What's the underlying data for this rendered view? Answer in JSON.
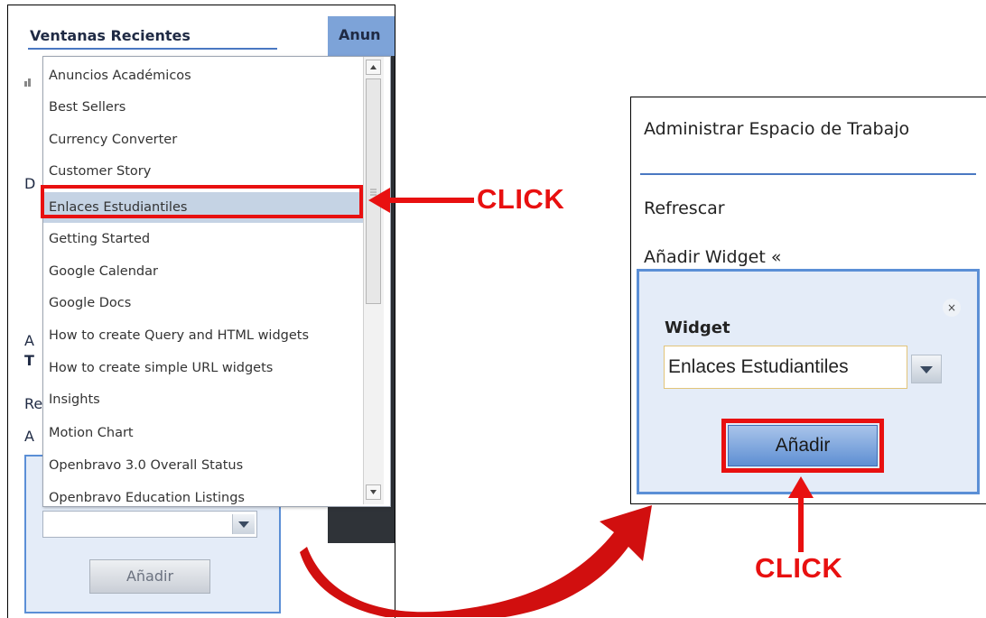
{
  "left": {
    "section_title": "Ventanas Recientes",
    "tab_title": "Anun",
    "peek_d": "D",
    "peek_ad": "A",
    "peek_tr": "T",
    "peek_re": "Re",
    "peek_an": "A",
    "add_button": "Añadir",
    "dropdown": {
      "items": [
        "Anuncios Académicos",
        "Best Sellers",
        "Currency Converter",
        "Customer Story",
        "Enlaces Estudiantiles",
        "Getting Started",
        "Google Calendar",
        "Google Docs",
        "How to create Query and HTML widgets",
        "How to create simple URL widgets",
        "Insights",
        "Motion Chart",
        "Openbravo 3.0 Overall Status",
        "Openbravo Education Listings"
      ],
      "selected_index": 4
    }
  },
  "right": {
    "title": "Administrar Espacio de Trabajo",
    "refresh": "Refrescar",
    "add_widget": "Añadir Widget «",
    "close_icon": "×",
    "widget_label": "Widget",
    "widget_value": "Enlaces Estudiantiles",
    "add_button": "Añadir"
  },
  "annotations": {
    "click_1": "CLICK",
    "click_2": "CLICK",
    "color": "#e81010"
  }
}
